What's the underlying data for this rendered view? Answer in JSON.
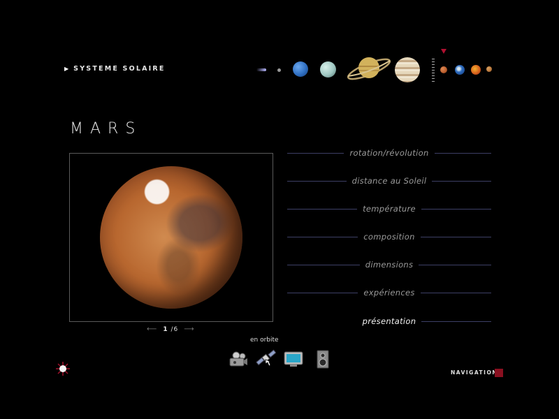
{
  "header": {
    "breadcrumb_label": "SYSTEME SOLAIRE",
    "planets": [
      {
        "name": "comet",
        "color": "#b7b7ff"
      },
      {
        "name": "pluto",
        "color": "#9a9a9a"
      },
      {
        "name": "neptune",
        "color": "#2f6fc2"
      },
      {
        "name": "uranus",
        "color": "#9fc7c2"
      },
      {
        "name": "saturn",
        "color": "#d2b25c"
      },
      {
        "name": "jupiter",
        "color": "#d7c7a8"
      },
      {
        "name": "asteroid-belt",
        "color": "#aaaaaa"
      },
      {
        "name": "mars",
        "color": "#b85c2c"
      },
      {
        "name": "earth",
        "color": "#2d6cc0"
      },
      {
        "name": "venus",
        "color": "#d25a1c"
      },
      {
        "name": "mercury",
        "color": "#b9783c"
      }
    ],
    "current_marker_color": "#b01030"
  },
  "planet_title": "MARS",
  "pager": {
    "current": "1",
    "total": "6"
  },
  "menu": [
    {
      "label": "rotation/révolution",
      "active": false
    },
    {
      "label": "distance au Soleil",
      "active": false
    },
    {
      "label": "température",
      "active": false
    },
    {
      "label": "composition",
      "active": false
    },
    {
      "label": "dimensions",
      "active": false
    },
    {
      "label": "expériences",
      "active": false
    },
    {
      "label": "présentation",
      "active": true
    }
  ],
  "toolbar": {
    "hover_label": "en orbite",
    "tools": [
      "video-camera-icon",
      "satellite-icon",
      "monitor-icon",
      "speaker-icon"
    ]
  },
  "navigation": {
    "label": "NAVIGATION",
    "accent_color": "#8a1020"
  }
}
